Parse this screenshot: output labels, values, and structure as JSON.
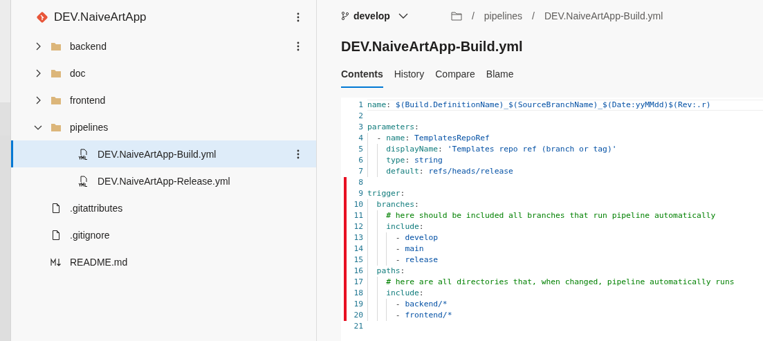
{
  "repo": {
    "name": "DEV.NaiveArtApp"
  },
  "tree": [
    {
      "kind": "folder",
      "label": "backend",
      "expanded": false,
      "selected": false,
      "more": true
    },
    {
      "kind": "folder",
      "label": "doc",
      "expanded": false,
      "selected": false,
      "more": false
    },
    {
      "kind": "folder",
      "label": "frontend",
      "expanded": false,
      "selected": false,
      "more": false
    },
    {
      "kind": "folder",
      "label": "pipelines",
      "expanded": true,
      "selected": false,
      "more": false,
      "children": [
        {
          "kind": "yml",
          "label": "DEV.NaiveArtApp-Build.yml",
          "selected": true,
          "more": true
        },
        {
          "kind": "yml",
          "label": "DEV.NaiveArtApp-Release.yml",
          "selected": false,
          "more": false
        }
      ]
    },
    {
      "kind": "file",
      "label": ".gitattributes",
      "selected": false,
      "more": false
    },
    {
      "kind": "file",
      "label": ".gitignore",
      "selected": false,
      "more": false
    },
    {
      "kind": "markdown",
      "label": "README.md",
      "selected": false,
      "more": false
    }
  ],
  "branch": {
    "name": "develop"
  },
  "breadcrumb": [
    {
      "separator": "/",
      "label": "pipelines"
    },
    {
      "separator": "/",
      "label": "DEV.NaiveArtApp-Build.yml"
    }
  ],
  "file_title": "DEV.NaiveArtApp-Build.yml",
  "tabs": [
    {
      "label": "Contents",
      "selected": true
    },
    {
      "label": "History",
      "selected": false
    },
    {
      "label": "Compare",
      "selected": false
    },
    {
      "label": "Blame",
      "selected": false
    }
  ],
  "code": [
    {
      "number": "1",
      "changed": false,
      "current": true,
      "tokens": [
        {
          "kind": "key",
          "text": "name"
        },
        {
          "kind": "punct",
          "text": ": "
        },
        {
          "kind": "value",
          "text": "$(Build.DefinitionName)_$(SourceBranchName)_$(Date:yyMMdd)$(Rev:.r)"
        }
      ]
    },
    {
      "number": "2",
      "changed": false,
      "current": false
    },
    {
      "number": "3",
      "changed": false,
      "current": false,
      "tokens": [
        {
          "kind": "key",
          "text": "parameters"
        },
        {
          "kind": "punct",
          "text": ":"
        }
      ]
    },
    {
      "number": "4",
      "changed": false,
      "current": false,
      "tokens": [
        {
          "kind": "punct",
          "text": "  - "
        },
        {
          "kind": "key",
          "text": "name"
        },
        {
          "kind": "punct",
          "text": ": "
        },
        {
          "kind": "value",
          "text": "TemplatesRepoRef"
        }
      ]
    },
    {
      "number": "5",
      "changed": false,
      "current": false,
      "tokens": [
        {
          "kind": "key",
          "text": "    displayName"
        },
        {
          "kind": "punct",
          "text": ": "
        },
        {
          "kind": "value",
          "text": "'Templates repo ref (branch or tag)'"
        }
      ]
    },
    {
      "number": "6",
      "changed": false,
      "current": false,
      "tokens": [
        {
          "kind": "key",
          "text": "    type"
        },
        {
          "kind": "punct",
          "text": ": "
        },
        {
          "kind": "value",
          "text": "string"
        }
      ]
    },
    {
      "number": "7",
      "changed": false,
      "current": false,
      "tokens": [
        {
          "kind": "key",
          "text": "    default"
        },
        {
          "kind": "punct",
          "text": ": "
        },
        {
          "kind": "value",
          "text": "refs/heads/release"
        }
      ]
    },
    {
      "number": "8",
      "changed": true,
      "current": false
    },
    {
      "number": "9",
      "changed": true,
      "current": false,
      "tokens": [
        {
          "kind": "key",
          "text": "trigger"
        },
        {
          "kind": "punct",
          "text": ":"
        }
      ]
    },
    {
      "number": "10",
      "changed": true,
      "current": false,
      "tokens": [
        {
          "kind": "key",
          "text": "  branches"
        },
        {
          "kind": "punct",
          "text": ":"
        }
      ]
    },
    {
      "number": "11",
      "changed": true,
      "current": false,
      "tokens": [
        {
          "kind": "comment",
          "text": "    # here should be included all branches that run pipeline automatically"
        }
      ]
    },
    {
      "number": "12",
      "changed": true,
      "current": false,
      "tokens": [
        {
          "kind": "key",
          "text": "    include"
        },
        {
          "kind": "punct",
          "text": ":"
        }
      ]
    },
    {
      "number": "13",
      "changed": true,
      "current": false,
      "tokens": [
        {
          "kind": "punct",
          "text": "      - "
        },
        {
          "kind": "value",
          "text": "develop"
        }
      ]
    },
    {
      "number": "14",
      "changed": true,
      "current": false,
      "tokens": [
        {
          "kind": "punct",
          "text": "      - "
        },
        {
          "kind": "value",
          "text": "main"
        }
      ]
    },
    {
      "number": "15",
      "changed": true,
      "current": false,
      "tokens": [
        {
          "kind": "punct",
          "text": "      - "
        },
        {
          "kind": "value",
          "text": "release"
        }
      ]
    },
    {
      "number": "16",
      "changed": true,
      "current": false,
      "tokens": [
        {
          "kind": "key",
          "text": "  paths"
        },
        {
          "kind": "punct",
          "text": ":"
        }
      ]
    },
    {
      "number": "17",
      "changed": true,
      "current": false,
      "tokens": [
        {
          "kind": "comment",
          "text": "    # here are all directories that, when changed, pipeline automatically runs"
        }
      ]
    },
    {
      "number": "18",
      "changed": true,
      "current": false,
      "tokens": [
        {
          "kind": "key",
          "text": "    include"
        },
        {
          "kind": "punct",
          "text": ":"
        }
      ]
    },
    {
      "number": "19",
      "changed": true,
      "current": false,
      "tokens": [
        {
          "kind": "punct",
          "text": "      - "
        },
        {
          "kind": "value",
          "text": "backend/*"
        }
      ]
    },
    {
      "number": "20",
      "changed": true,
      "current": false,
      "tokens": [
        {
          "kind": "punct",
          "text": "      - "
        },
        {
          "kind": "value",
          "text": "frontend/*"
        }
      ]
    },
    {
      "number": "21",
      "changed": false,
      "current": false
    }
  ]
}
